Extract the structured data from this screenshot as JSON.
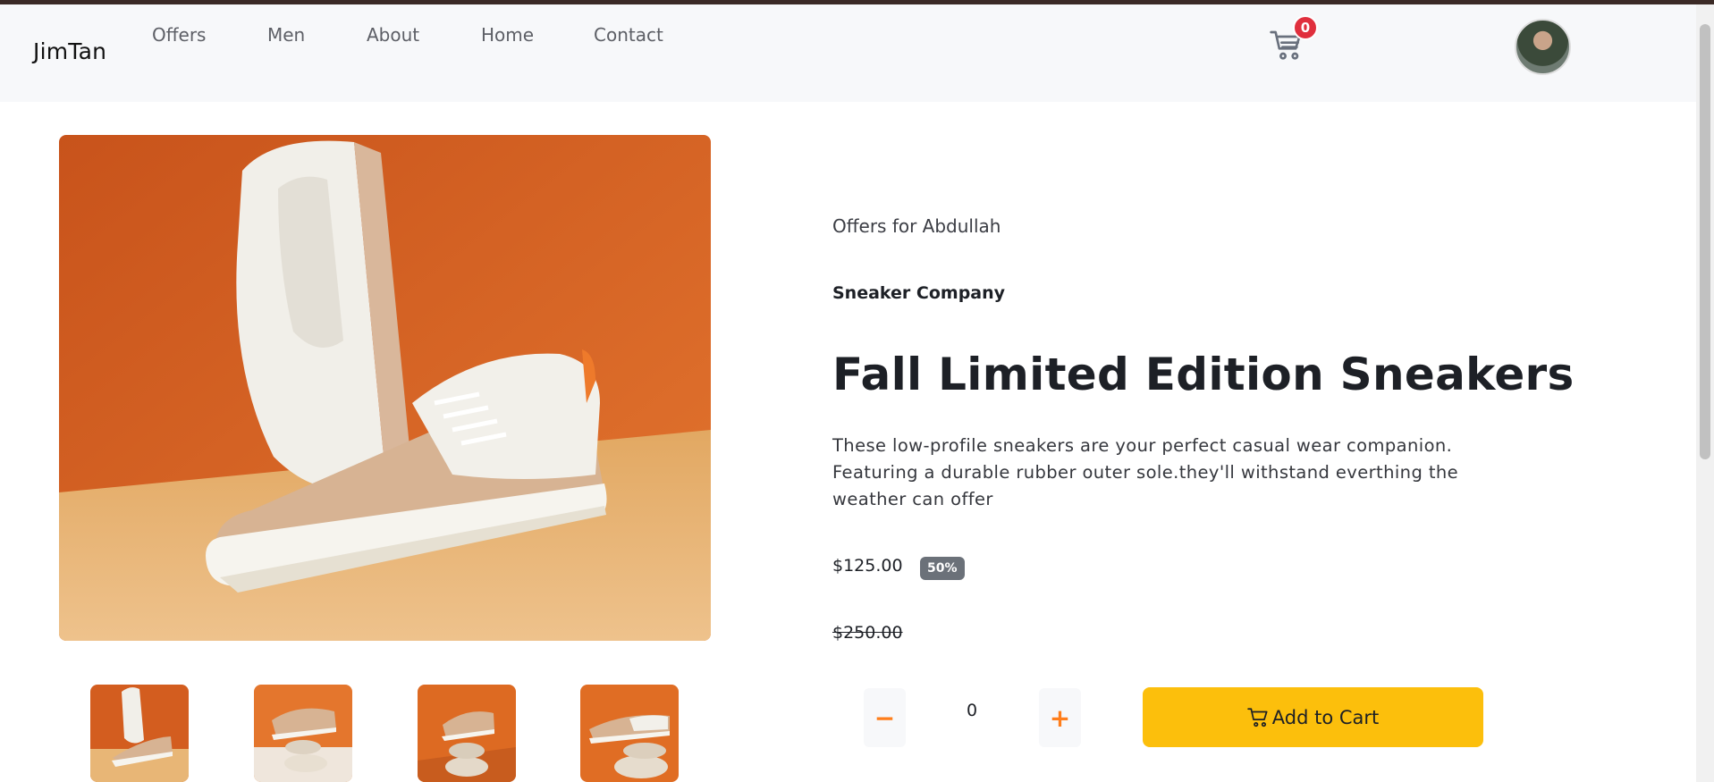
{
  "navbar": {
    "brand": "JimTan",
    "links": [
      "Offers",
      "Men",
      "About",
      "Home",
      "Contact"
    ],
    "cart_icon": "cart-icon",
    "cart_count": "0"
  },
  "product": {
    "eyebrow": "Offers for Abdullah",
    "company": "Sneaker Company",
    "title": "Fall Limited Edition Sneakers",
    "description": "These low-profile sneakers are your perfect casual wear companion. Featuring a durable rubber outer sole.they'll withstand everthing the weather can offer",
    "price": "$125.00",
    "discount": "50%",
    "old_price": "$250.00",
    "quantity": "0",
    "minus_label": "−",
    "plus_label": "+",
    "add_to_cart": "Add to Cart"
  },
  "colors": {
    "accent": "#ff7e1b",
    "button": "#fcbf0c",
    "badge": "#e02f3d"
  }
}
